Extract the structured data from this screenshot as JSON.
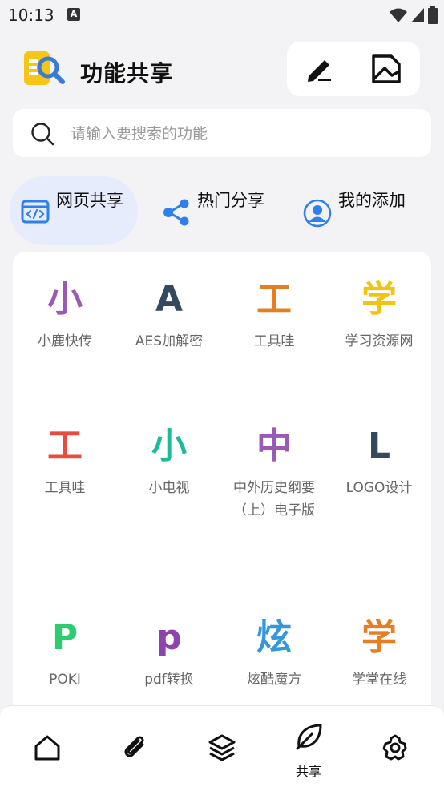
{
  "status_bar": {
    "time": "10:13",
    "notification_badge": "A"
  },
  "header": {
    "title": "功能共享",
    "actions": [
      {
        "icon": "edit-icon"
      },
      {
        "icon": "image-frame-icon"
      }
    ]
  },
  "search": {
    "placeholder": "请输入要搜索的功能",
    "value": ""
  },
  "tabs": [
    {
      "label": "网页共享",
      "icon": "web-code-icon",
      "active": true
    },
    {
      "label": "热门分享",
      "icon": "share-icon",
      "active": false
    },
    {
      "label": "我的添加",
      "icon": "user-circle-icon",
      "active": false
    }
  ],
  "items": [
    {
      "letter": "小",
      "label": "小鹿快传",
      "color": "#9b59b6"
    },
    {
      "letter": "A",
      "label": "AES加解密",
      "color": "#34495e"
    },
    {
      "letter": "工",
      "label": "工具哇",
      "color": "#e67e22"
    },
    {
      "letter": "学",
      "label": "学习资源网",
      "color": "#f1c40f"
    },
    {
      "letter": "工",
      "label": "工具哇",
      "color": "#e74c3c"
    },
    {
      "letter": "小",
      "label": "小电视",
      "color": "#1abc9c"
    },
    {
      "letter": "中",
      "label": "中外历史纲要（上）电子版",
      "color": "#9b59b6"
    },
    {
      "letter": "L",
      "label": "LOGO设计",
      "color": "#34495e"
    },
    {
      "letter": "P",
      "label": "POKI",
      "color": "#2ecc71"
    },
    {
      "letter": "p",
      "label": "pdf转换",
      "color": "#8e44ad"
    },
    {
      "letter": "炫",
      "label": "炫酷魔方",
      "color": "#3498db"
    },
    {
      "letter": "学",
      "label": "学堂在线",
      "color": "#e67e22"
    }
  ],
  "bottom_nav": [
    {
      "icon": "home-icon",
      "label": ""
    },
    {
      "icon": "attachment-icon",
      "label": ""
    },
    {
      "icon": "layers-icon",
      "label": ""
    },
    {
      "icon": "leaf-icon",
      "label": "共享"
    },
    {
      "icon": "settings-icon",
      "label": ""
    }
  ],
  "colors": {
    "accent": "#2f80ed",
    "active_tab_bg": "#e7ecfc"
  }
}
